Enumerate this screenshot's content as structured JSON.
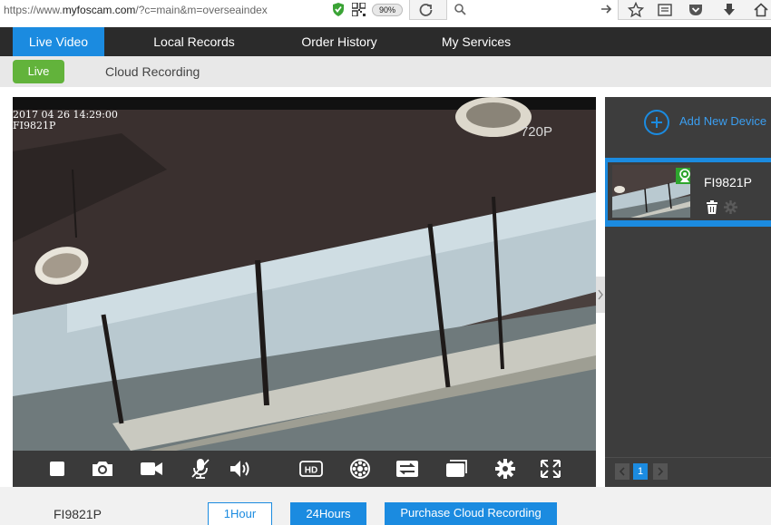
{
  "browser": {
    "url_prefix": "https://www.",
    "url_domain": "myfoscam.com",
    "url_rest": "/?c=main&m=overseaindex",
    "zoom": "90%",
    "icons": [
      "shield-icon",
      "qr-code-icon",
      "reload-icon",
      "search-icon",
      "go-arrow-icon",
      "star-icon",
      "reading-list-icon",
      "pocket-icon",
      "download-icon",
      "home-icon"
    ]
  },
  "nav": {
    "tabs": [
      {
        "label": "Live Video",
        "active": true
      },
      {
        "label": "Local Records",
        "active": false
      },
      {
        "label": "Order History",
        "active": false
      },
      {
        "label": "My Services",
        "active": false
      }
    ]
  },
  "subnav": {
    "live_label": "Live",
    "cloud_label": "Cloud Recording"
  },
  "video": {
    "timestamp": "2017 04 26 14:29:00",
    "camera_name": "FI9821P",
    "resolution": "720P"
  },
  "controls": {
    "items": [
      "stop-icon",
      "snapshot-icon",
      "record-icon",
      "microphone-off-icon",
      "volume-icon",
      "hd-icon",
      "ptz-icon",
      "mirror-flip-icon",
      "window-icon",
      "settings-icon",
      "fullscreen-icon"
    ],
    "hd_label": "HD"
  },
  "devices": {
    "add_label": "Add New Device",
    "list": [
      {
        "name": "FI9821P"
      }
    ],
    "page": "1"
  },
  "bottom": {
    "device_name": "FI9821P",
    "btn_1h": "1Hour",
    "btn_24h": "24Hours",
    "btn_buy": "Purchase Cloud Recording"
  },
  "colors": {
    "accent": "#1b8be0",
    "live_green": "#62b33b",
    "nav_bg": "#2b2b2b",
    "panel_bg": "#3d3d3d"
  }
}
